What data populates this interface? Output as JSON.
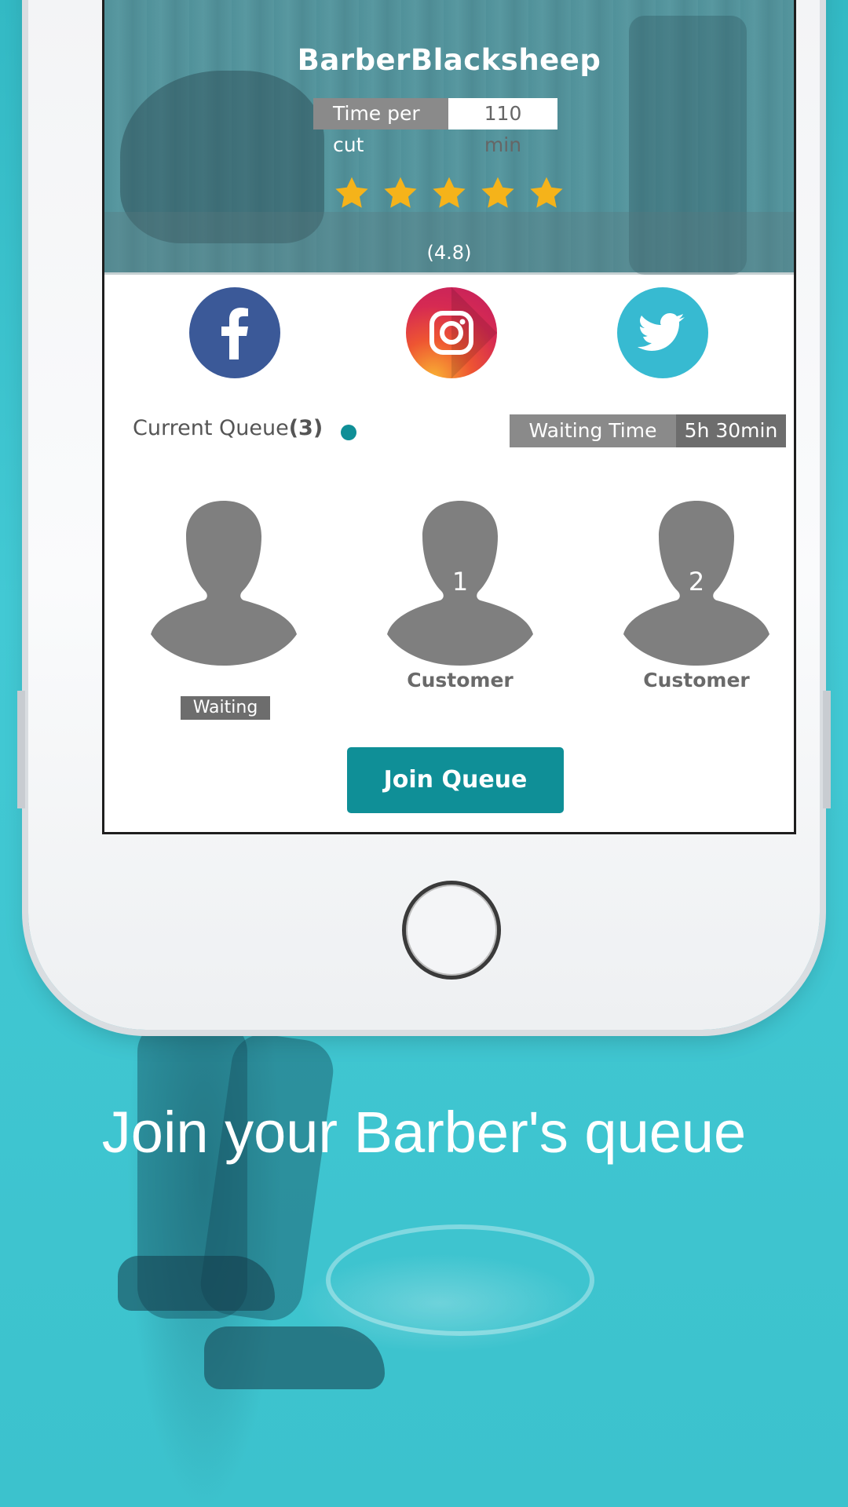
{
  "shop": {
    "name": "BarberBlacksheep",
    "time_per_cut_label": "Time per cut",
    "time_per_cut_value": "110 min",
    "rating_stars": 5,
    "rating_text": "(4.8)"
  },
  "social": {
    "facebook_icon": "facebook-icon",
    "instagram_icon": "instagram-icon",
    "twitter_icon": "twitter-icon"
  },
  "queue": {
    "label": "Current Queue",
    "count": "(3)",
    "status_color": "#0f8f97",
    "waiting_time_label": "Waiting Time",
    "waiting_time_value": "5h 30min",
    "people": [
      {
        "number": "",
        "label": "",
        "tag": "Waiting"
      },
      {
        "number": "1",
        "label": "Customer",
        "tag": ""
      },
      {
        "number": "2",
        "label": "Customer",
        "tag": ""
      }
    ],
    "join_button": "Join Queue"
  },
  "colors": {
    "accent": "#0f8f97",
    "background": "#3fc6d1",
    "star": "#f5b31a"
  },
  "tagline": "Join your Barber's queue"
}
